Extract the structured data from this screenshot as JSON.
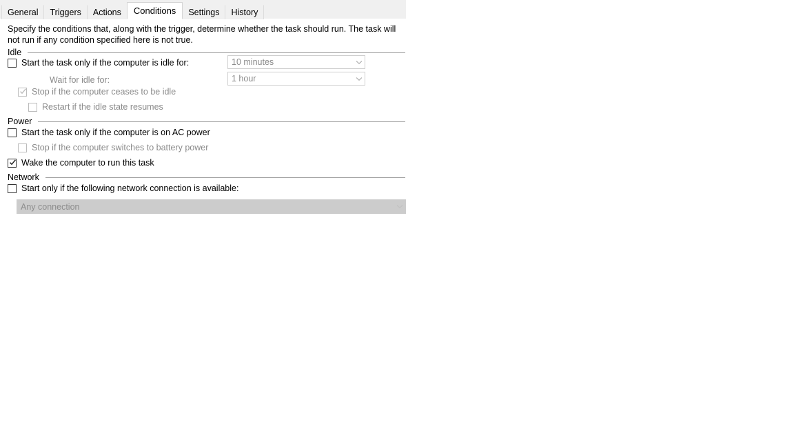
{
  "tabs": [
    {
      "label": "General",
      "selected": false
    },
    {
      "label": "Triggers",
      "selected": false
    },
    {
      "label": "Actions",
      "selected": false
    },
    {
      "label": "Conditions",
      "selected": true
    },
    {
      "label": "Settings",
      "selected": false
    },
    {
      "label": "History",
      "selected": false
    }
  ],
  "description": "Specify the conditions that, along with the trigger, determine whether the task should run.  The task will not run  if any condition specified here is not true.",
  "groups": {
    "idle": {
      "label": "Idle"
    },
    "power": {
      "label": "Power"
    },
    "network": {
      "label": "Network"
    }
  },
  "idle": {
    "start_if_idle": {
      "label": "Start the task only if the computer is idle for:",
      "checked": false,
      "enabled": true
    },
    "idle_duration": {
      "value": "10 minutes",
      "enabled": false
    },
    "wait_for_idle_label": "Wait for idle for:",
    "wait_for_idle": {
      "value": "1 hour",
      "enabled": false
    },
    "stop_if_ceases_idle": {
      "label": "Stop if the computer ceases to be idle",
      "checked": true,
      "enabled": false
    },
    "restart_if_idle_resumes": {
      "label": "Restart if the idle state resumes",
      "checked": false,
      "enabled": false
    }
  },
  "power": {
    "only_on_ac": {
      "label": "Start the task only if the computer is on AC power",
      "checked": false,
      "enabled": true
    },
    "stop_on_battery": {
      "label": "Stop if the computer switches to battery power",
      "checked": false,
      "enabled": false
    },
    "wake_computer": {
      "label": "Wake the computer to run this task",
      "checked": true,
      "enabled": true
    }
  },
  "network": {
    "start_if_network": {
      "label": "Start only if the following network connection is available:",
      "checked": false,
      "enabled": true
    },
    "connection": {
      "value": "Any connection",
      "enabled": false
    }
  },
  "icons": {
    "checkmark": "check-icon",
    "dropdown": "chevron-down-icon"
  },
  "colors": {
    "tabstrip_bg": "#f0f0f0",
    "page_bg": "#ffffff",
    "rule": "#a0a0a0",
    "disabled_text": "#8a8a8a",
    "combo_border": "#cfcfcf",
    "combo_flat_bg": "#cccccc"
  }
}
